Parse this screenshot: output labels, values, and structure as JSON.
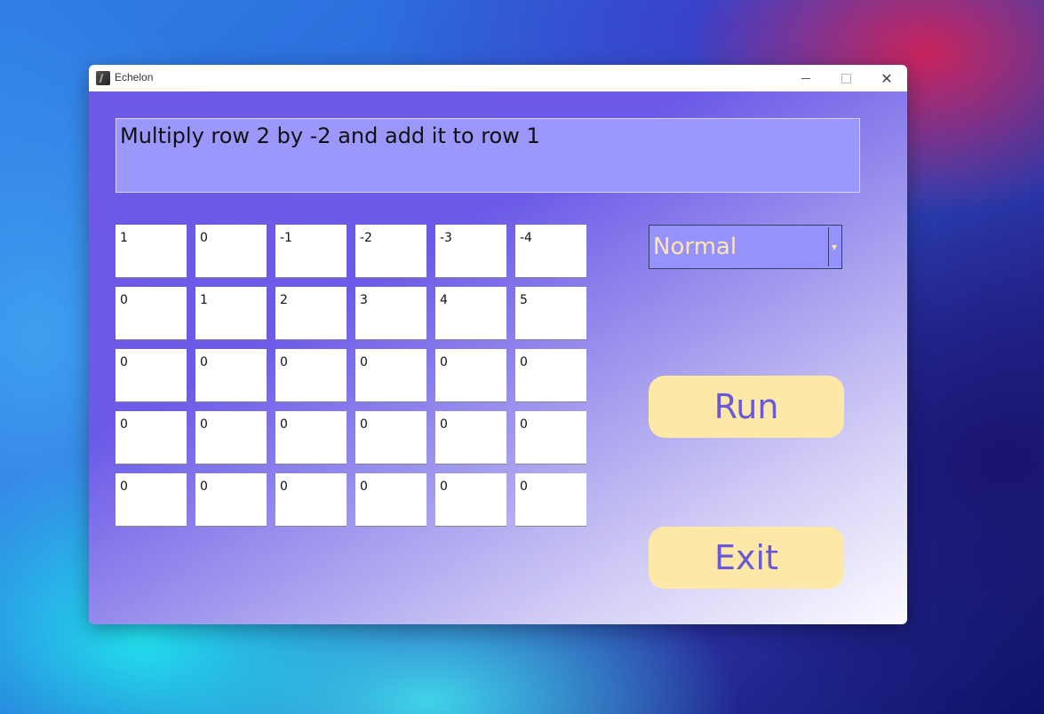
{
  "window": {
    "title": "Echelon"
  },
  "message": "Multiply row 2 by -2 and add it to row 1",
  "matrix": {
    "rows": [
      [
        "1",
        "0",
        "-1",
        "-2",
        "-3",
        "-4"
      ],
      [
        "0",
        "1",
        "2",
        "3",
        "4",
        "5"
      ],
      [
        "0",
        "0",
        "0",
        "0",
        "0",
        "0"
      ],
      [
        "0",
        "0",
        "0",
        "0",
        "0",
        "0"
      ],
      [
        "0",
        "0",
        "0",
        "0",
        "0",
        "0"
      ]
    ]
  },
  "mode_select": {
    "selected": "Normal"
  },
  "buttons": {
    "run_label": "Run",
    "exit_label": "Exit"
  },
  "icons": {
    "app": "echelon-app-icon",
    "minimize": "minimize-icon",
    "maximize": "maximize-icon",
    "close": "close-icon",
    "dropdown": "chevron-down-icon"
  },
  "colors": {
    "button_bg": "#fde8a8",
    "button_text": "#6a58d8",
    "message_bg": "#9b97fb",
    "select_text": "#ffe4b0"
  }
}
